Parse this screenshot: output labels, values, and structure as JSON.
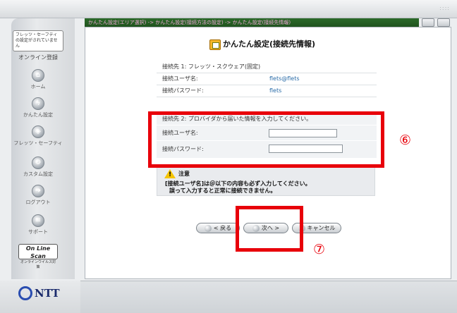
{
  "window": {
    "breadcrumb": "かんたん設定(エリア選択) -> かんたん設定(接続方法の設定) -> かんたん設定(接続先情報)",
    "corner_dots": "::::"
  },
  "sidebar": {
    "badge": "フレッツ・セーフティの設定がされていません",
    "online": "オンライン登録",
    "items": [
      {
        "label": "ホーム",
        "icon": "home-icon"
      },
      {
        "label": "かんたん設定",
        "icon": "lightning-icon"
      },
      {
        "label": "フレッツ・セーフティ",
        "icon": "shield-icon"
      },
      {
        "label": "カスタム設定",
        "icon": "wrench-icon"
      },
      {
        "label": "ログアウト",
        "icon": "logout-icon"
      },
      {
        "label": "サポート",
        "icon": "support-icon"
      }
    ],
    "online_scan": {
      "title": "On Line Scan",
      "subtitle": "オンラインウイルス対策"
    }
  },
  "logo": {
    "text": "NTT"
  },
  "main": {
    "title": "かんたん設定(接続先情報)",
    "section1": {
      "heading": "接続先 1:  フレッツ・スクウェア(固定)",
      "rows": [
        {
          "label": "接続ユーザ名:",
          "value": "flets@flets"
        },
        {
          "label": "接続パスワード:",
          "value": "flets"
        }
      ]
    },
    "section2": {
      "heading": "接続先 2:  プロバイダから届いた情報を入力してください。",
      "user_label": "接続ユーザ名:",
      "user_value": "",
      "pass_label": "接続パスワード:",
      "pass_value": ""
    },
    "notice": {
      "heading": "注意",
      "line1": "[接続ユーザ名]は＠以下の内容も必ず入力してください。",
      "line2": "誤って入力すると正常に接続できません。"
    },
    "buttons": {
      "back": "< 戻る",
      "next": "次へ >",
      "cancel": "キャンセル"
    }
  },
  "annotations": {
    "six": "⑥",
    "seven": "⑦"
  }
}
